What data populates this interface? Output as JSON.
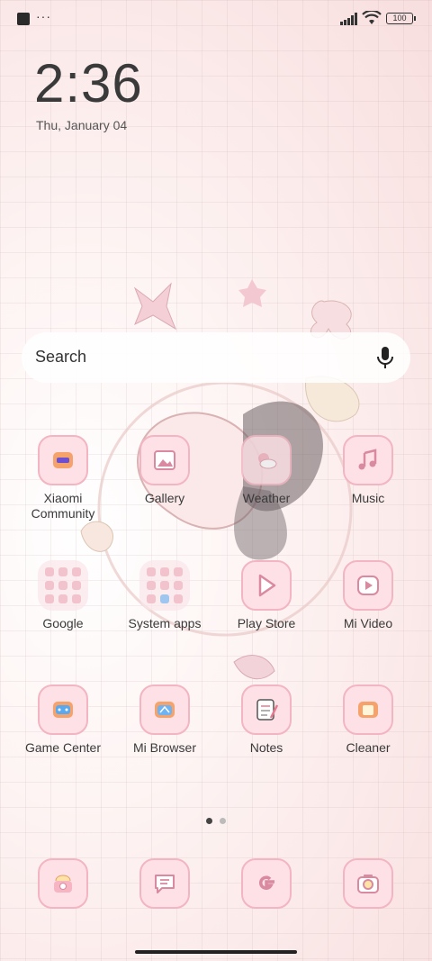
{
  "status_bar": {
    "battery": "100",
    "overflow": "···"
  },
  "clock": {
    "time": "2:36",
    "date": "Thu, January 04"
  },
  "search": {
    "placeholder": "Search"
  },
  "apps": [
    {
      "label": "Xiaomi Community",
      "icon": "xiaomi-community-icon"
    },
    {
      "label": "Gallery",
      "icon": "gallery-icon"
    },
    {
      "label": "Weather",
      "icon": "weather-icon"
    },
    {
      "label": "Music",
      "icon": "music-icon"
    },
    {
      "label": "Google",
      "icon": "google-folder-icon"
    },
    {
      "label": "System apps",
      "icon": "system-apps-folder-icon"
    },
    {
      "label": "Play Store",
      "icon": "play-store-icon"
    },
    {
      "label": "Mi Video",
      "icon": "mi-video-icon"
    },
    {
      "label": "Game Center",
      "icon": "game-center-icon"
    },
    {
      "label": "Mi Browser",
      "icon": "mi-browser-icon"
    },
    {
      "label": "Notes",
      "icon": "notes-icon"
    },
    {
      "label": "Cleaner",
      "icon": "cleaner-icon"
    }
  ],
  "dock": [
    {
      "icon": "phone-icon"
    },
    {
      "icon": "messages-icon"
    },
    {
      "icon": "google-icon"
    },
    {
      "icon": "camera-icon"
    }
  ],
  "colors": {
    "tile_bg": "#fde1e6",
    "tile_border": "#f3b5c2",
    "accent": "#e88aa0"
  },
  "page_indicator": {
    "pages": 2,
    "current": 1
  }
}
